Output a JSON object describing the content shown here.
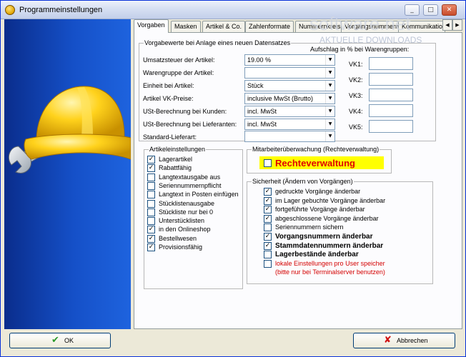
{
  "window": {
    "title": "Programmeinstellungen",
    "controls": {
      "minimize": "_",
      "maximize": "□",
      "close": "✕"
    }
  },
  "tabs": [
    {
      "label": "Vorgaben",
      "active": true
    },
    {
      "label": "Masken"
    },
    {
      "label": "Artikel & Co."
    },
    {
      "label": "Zahlenformate"
    },
    {
      "label": "Nummernkreise"
    },
    {
      "label": "Vorgangsnummern"
    },
    {
      "label": "Kommunikation"
    }
  ],
  "tab_scroll": {
    "left": "◀",
    "right": "▶"
  },
  "watermark": {
    "text": "software.net",
    "sub": "AKTUELLE DOWNLOADS"
  },
  "defaults_group": {
    "title": "Vorgabewerte bei Anlage eines neuen Datensatzes",
    "fields": [
      {
        "label": "Umsatzsteuer der Artikel:",
        "value": "19.00 %"
      },
      {
        "label": "Warengruppe der Artikel:",
        "value": ""
      },
      {
        "label": "Einheit bei Artikel:",
        "value": "Stück"
      },
      {
        "label": "Artikel VK-Preise:",
        "value": "inclusive MwSt (Brutto)"
      },
      {
        "label": "USt-Berechnung bei Kunden:",
        "value": "incl. MwSt"
      },
      {
        "label": "USt-Berechnung bei Lieferanten:",
        "value": "incl. MwSt"
      },
      {
        "label": "Standard-Lieferart:",
        "value": ""
      }
    ],
    "surcharge_title": "Aufschlag in % bei Warengruppen:",
    "vk": [
      {
        "label": "VK1:",
        "value": ""
      },
      {
        "label": "VK2:",
        "value": ""
      },
      {
        "label": "VK3:",
        "value": ""
      },
      {
        "label": "VK4:",
        "value": ""
      },
      {
        "label": "VK5:",
        "value": ""
      }
    ]
  },
  "article_settings": {
    "title": "Artikeleinstellungen",
    "items": [
      {
        "label": "Lagerartikel",
        "checked": true
      },
      {
        "label": "Rabattfähig",
        "checked": true
      },
      {
        "label": "Langtextausgabe aus",
        "checked": false
      },
      {
        "label": "Seriennummernpflicht",
        "checked": false
      },
      {
        "label": "Langtext in Posten einfügen",
        "checked": false
      },
      {
        "label": "Stücklistenausgabe",
        "checked": false
      },
      {
        "label": "Stückliste nur bei 0",
        "checked": false
      },
      {
        "label": "Unterstücklisten",
        "checked": false
      },
      {
        "label": "in den Onlineshop",
        "checked": true
      },
      {
        "label": "Bestellwesen",
        "checked": true
      },
      {
        "label": "Provisionsfähig",
        "checked": true
      }
    ]
  },
  "employee_monitoring": {
    "title": "Mitarbeiterüberwachung (Rechteverwaltung)",
    "item": {
      "label": "Rechteverwaltung",
      "checked": false
    }
  },
  "security": {
    "title": "Sicherheit (Ändern von Vorgängen)",
    "items": [
      {
        "label": "gedruckte Vorgänge änderbar",
        "checked": true
      },
      {
        "label": "im Lager gebuchte Vorgänge änderbar",
        "checked": true
      },
      {
        "label": "fortgeführte Vorgänge änderbar",
        "checked": true
      },
      {
        "label": "abgeschlossene Vorgänge änderbar",
        "checked": true
      },
      {
        "label": "Seriennummern sichern",
        "checked": false
      },
      {
        "label": "Vorgangsnummern änderbar",
        "checked": true,
        "bold": true
      },
      {
        "label": "Stammdatennummern änderbar",
        "checked": true,
        "bold": true
      },
      {
        "label": "Lagerbestände änderbar",
        "checked": false,
        "bold": true
      },
      {
        "label": "lokale Einstellungen pro User speicher",
        "checked": false,
        "red": true
      },
      {
        "label": "(bitte nur bei Terminalserver benutzen)",
        "red": true
      }
    ]
  },
  "buttons": {
    "ok": {
      "label": "OK",
      "icon": "✔"
    },
    "cancel": {
      "label": "Abbrechen",
      "icon": "✘"
    }
  },
  "colors": {
    "accent": "#0831d9",
    "sidebar": "#1550c8",
    "highlight": "#ffff00",
    "warning_text": "#d40000",
    "ok_icon": "#2a9a2a",
    "cancel_icon": "#d01010"
  }
}
